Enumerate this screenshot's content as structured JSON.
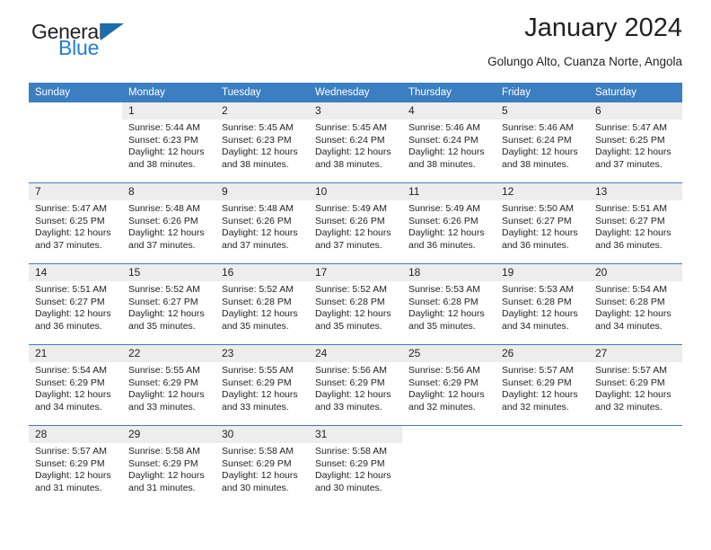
{
  "brand": {
    "name_top": "General",
    "name_bottom": "Blue",
    "accent_color": "#1f7fd0",
    "triangle_color": "#1b6cb0"
  },
  "header": {
    "title": "January 2024",
    "subtitle": "Golungo Alto, Cuanza Norte, Angola",
    "header_bg": "#3b7ec1",
    "daynum_bg": "#ededed"
  },
  "weekday_headers": [
    "Sunday",
    "Monday",
    "Tuesday",
    "Wednesday",
    "Thursday",
    "Friday",
    "Saturday"
  ],
  "labels": {
    "sunrise_prefix": "Sunrise:",
    "sunset_prefix": "Sunset:",
    "daylight_prefix": "Daylight:"
  },
  "weeks": [
    [
      {
        "day": "",
        "lines": []
      },
      {
        "day": "1",
        "lines": [
          "Sunrise: 5:44 AM",
          "Sunset: 6:23 PM",
          "Daylight: 12 hours",
          "and 38 minutes."
        ]
      },
      {
        "day": "2",
        "lines": [
          "Sunrise: 5:45 AM",
          "Sunset: 6:23 PM",
          "Daylight: 12 hours",
          "and 38 minutes."
        ]
      },
      {
        "day": "3",
        "lines": [
          "Sunrise: 5:45 AM",
          "Sunset: 6:24 PM",
          "Daylight: 12 hours",
          "and 38 minutes."
        ]
      },
      {
        "day": "4",
        "lines": [
          "Sunrise: 5:46 AM",
          "Sunset: 6:24 PM",
          "Daylight: 12 hours",
          "and 38 minutes."
        ]
      },
      {
        "day": "5",
        "lines": [
          "Sunrise: 5:46 AM",
          "Sunset: 6:24 PM",
          "Daylight: 12 hours",
          "and 38 minutes."
        ]
      },
      {
        "day": "6",
        "lines": [
          "Sunrise: 5:47 AM",
          "Sunset: 6:25 PM",
          "Daylight: 12 hours",
          "and 37 minutes."
        ]
      }
    ],
    [
      {
        "day": "7",
        "lines": [
          "Sunrise: 5:47 AM",
          "Sunset: 6:25 PM",
          "Daylight: 12 hours",
          "and 37 minutes."
        ]
      },
      {
        "day": "8",
        "lines": [
          "Sunrise: 5:48 AM",
          "Sunset: 6:26 PM",
          "Daylight: 12 hours",
          "and 37 minutes."
        ]
      },
      {
        "day": "9",
        "lines": [
          "Sunrise: 5:48 AM",
          "Sunset: 6:26 PM",
          "Daylight: 12 hours",
          "and 37 minutes."
        ]
      },
      {
        "day": "10",
        "lines": [
          "Sunrise: 5:49 AM",
          "Sunset: 6:26 PM",
          "Daylight: 12 hours",
          "and 37 minutes."
        ]
      },
      {
        "day": "11",
        "lines": [
          "Sunrise: 5:49 AM",
          "Sunset: 6:26 PM",
          "Daylight: 12 hours",
          "and 36 minutes."
        ]
      },
      {
        "day": "12",
        "lines": [
          "Sunrise: 5:50 AM",
          "Sunset: 6:27 PM",
          "Daylight: 12 hours",
          "and 36 minutes."
        ]
      },
      {
        "day": "13",
        "lines": [
          "Sunrise: 5:51 AM",
          "Sunset: 6:27 PM",
          "Daylight: 12 hours",
          "and 36 minutes."
        ]
      }
    ],
    [
      {
        "day": "14",
        "lines": [
          "Sunrise: 5:51 AM",
          "Sunset: 6:27 PM",
          "Daylight: 12 hours",
          "and 36 minutes."
        ]
      },
      {
        "day": "15",
        "lines": [
          "Sunrise: 5:52 AM",
          "Sunset: 6:27 PM",
          "Daylight: 12 hours",
          "and 35 minutes."
        ]
      },
      {
        "day": "16",
        "lines": [
          "Sunrise: 5:52 AM",
          "Sunset: 6:28 PM",
          "Daylight: 12 hours",
          "and 35 minutes."
        ]
      },
      {
        "day": "17",
        "lines": [
          "Sunrise: 5:52 AM",
          "Sunset: 6:28 PM",
          "Daylight: 12 hours",
          "and 35 minutes."
        ]
      },
      {
        "day": "18",
        "lines": [
          "Sunrise: 5:53 AM",
          "Sunset: 6:28 PM",
          "Daylight: 12 hours",
          "and 35 minutes."
        ]
      },
      {
        "day": "19",
        "lines": [
          "Sunrise: 5:53 AM",
          "Sunset: 6:28 PM",
          "Daylight: 12 hours",
          "and 34 minutes."
        ]
      },
      {
        "day": "20",
        "lines": [
          "Sunrise: 5:54 AM",
          "Sunset: 6:28 PM",
          "Daylight: 12 hours",
          "and 34 minutes."
        ]
      }
    ],
    [
      {
        "day": "21",
        "lines": [
          "Sunrise: 5:54 AM",
          "Sunset: 6:29 PM",
          "Daylight: 12 hours",
          "and 34 minutes."
        ]
      },
      {
        "day": "22",
        "lines": [
          "Sunrise: 5:55 AM",
          "Sunset: 6:29 PM",
          "Daylight: 12 hours",
          "and 33 minutes."
        ]
      },
      {
        "day": "23",
        "lines": [
          "Sunrise: 5:55 AM",
          "Sunset: 6:29 PM",
          "Daylight: 12 hours",
          "and 33 minutes."
        ]
      },
      {
        "day": "24",
        "lines": [
          "Sunrise: 5:56 AM",
          "Sunset: 6:29 PM",
          "Daylight: 12 hours",
          "and 33 minutes."
        ]
      },
      {
        "day": "25",
        "lines": [
          "Sunrise: 5:56 AM",
          "Sunset: 6:29 PM",
          "Daylight: 12 hours",
          "and 32 minutes."
        ]
      },
      {
        "day": "26",
        "lines": [
          "Sunrise: 5:57 AM",
          "Sunset: 6:29 PM",
          "Daylight: 12 hours",
          "and 32 minutes."
        ]
      },
      {
        "day": "27",
        "lines": [
          "Sunrise: 5:57 AM",
          "Sunset: 6:29 PM",
          "Daylight: 12 hours",
          "and 32 minutes."
        ]
      }
    ],
    [
      {
        "day": "28",
        "lines": [
          "Sunrise: 5:57 AM",
          "Sunset: 6:29 PM",
          "Daylight: 12 hours",
          "and 31 minutes."
        ]
      },
      {
        "day": "29",
        "lines": [
          "Sunrise: 5:58 AM",
          "Sunset: 6:29 PM",
          "Daylight: 12 hours",
          "and 31 minutes."
        ]
      },
      {
        "day": "30",
        "lines": [
          "Sunrise: 5:58 AM",
          "Sunset: 6:29 PM",
          "Daylight: 12 hours",
          "and 30 minutes."
        ]
      },
      {
        "day": "31",
        "lines": [
          "Sunrise: 5:58 AM",
          "Sunset: 6:29 PM",
          "Daylight: 12 hours",
          "and 30 minutes."
        ]
      },
      {
        "day": "",
        "lines": []
      },
      {
        "day": "",
        "lines": []
      },
      {
        "day": "",
        "lines": []
      }
    ]
  ]
}
